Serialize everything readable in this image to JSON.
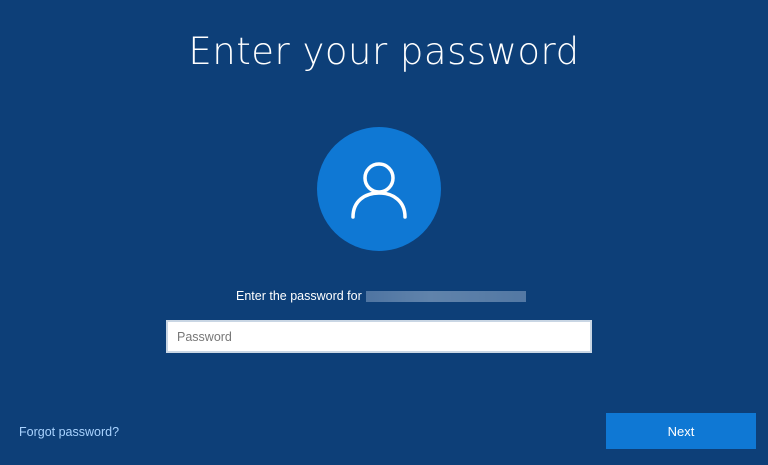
{
  "page": {
    "title": "Enter your password"
  },
  "account": {
    "prompt": "Enter the password for"
  },
  "password_field": {
    "placeholder": "Password",
    "value": ""
  },
  "links": {
    "forgot_password": "Forgot password?"
  },
  "actions": {
    "next_label": "Next"
  },
  "icons": {
    "avatar": "user-silhouette-icon"
  },
  "colors": {
    "background": "#0d3f78",
    "accent": "#0f78d4",
    "link": "#a9d3ff"
  }
}
